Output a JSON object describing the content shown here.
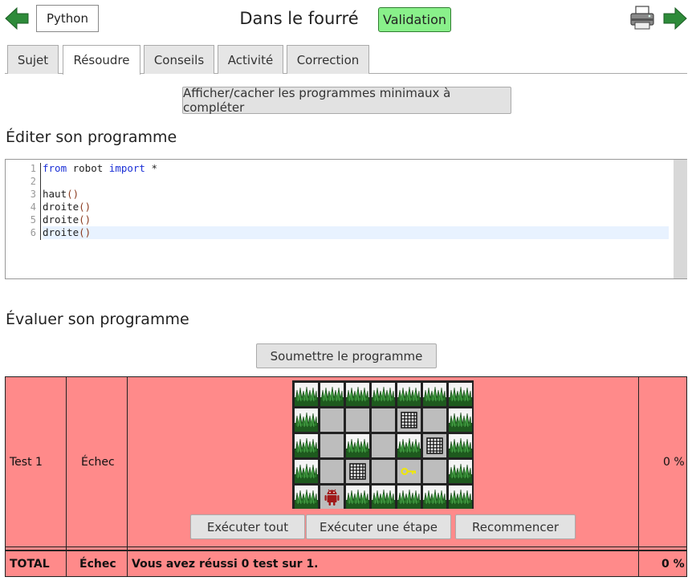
{
  "header": {
    "language_label": "Python",
    "title": "Dans le fourré",
    "validation_label": "Validation"
  },
  "tabs": [
    {
      "label": "Sujet"
    },
    {
      "label": "Résoudre"
    },
    {
      "label": "Conseils"
    },
    {
      "label": "Activité"
    },
    {
      "label": "Correction"
    }
  ],
  "toggle_button_label": "Afficher/cacher les programmes minimaux à compléter",
  "editor_section_title": "Éditer son programme",
  "editor": {
    "lines": [
      {
        "num": "1",
        "parts": [
          {
            "t": "from",
            "c": "kw"
          },
          {
            "t": " robot ",
            "c": ""
          },
          {
            "t": "import",
            "c": "kw"
          },
          {
            "t": " *",
            "c": ""
          }
        ]
      },
      {
        "num": "2",
        "parts": []
      },
      {
        "num": "3",
        "parts": [
          {
            "t": "haut",
            "c": ""
          },
          {
            "t": "()",
            "c": "paren"
          }
        ]
      },
      {
        "num": "4",
        "parts": [
          {
            "t": "droite",
            "c": ""
          },
          {
            "t": "()",
            "c": "paren"
          }
        ]
      },
      {
        "num": "5",
        "parts": [
          {
            "t": "droite",
            "c": ""
          },
          {
            "t": "()",
            "c": "paren"
          }
        ]
      },
      {
        "num": "6",
        "parts": [
          {
            "t": "droite",
            "c": ""
          },
          {
            "t": "()",
            "c": "paren"
          }
        ]
      }
    ]
  },
  "evaluate_section_title": "Évaluer son programme",
  "submit_label": "Soumettre le programme",
  "test": {
    "name": "Test 1",
    "status": "Échec",
    "score": "0 %",
    "grid": [
      [
        "grass",
        "grass",
        "grass",
        "grass",
        "grass",
        "grass",
        "grass"
      ],
      [
        "grass",
        "empty",
        "empty",
        "empty",
        "grid",
        "empty",
        "grass"
      ],
      [
        "grass",
        "empty",
        "grass",
        "empty",
        "grass",
        "grid",
        "grass"
      ],
      [
        "grass",
        "empty",
        "grid",
        "empty",
        "key",
        "empty",
        "grass"
      ],
      [
        "grass",
        "robot",
        "grass",
        "grass",
        "grass",
        "grass",
        "grass"
      ]
    ],
    "buttons": {
      "run_all": "Exécuter tout",
      "run_step": "Exécuter une étape",
      "restart": "Recommencer"
    }
  },
  "total": {
    "label": "TOTAL",
    "status": "Échec",
    "message": "Vous avez réussi 0 test sur 1.",
    "score": "0 %"
  },
  "colors": {
    "fail_background": "#ff8a8a",
    "validation_background": "#89f08a",
    "arrow_green": "#2e8b3a",
    "keyword_blue": "#1a2fd6"
  },
  "icons": {
    "prev": "arrow-left-icon",
    "next": "arrow-right-icon",
    "print": "printer-icon"
  }
}
